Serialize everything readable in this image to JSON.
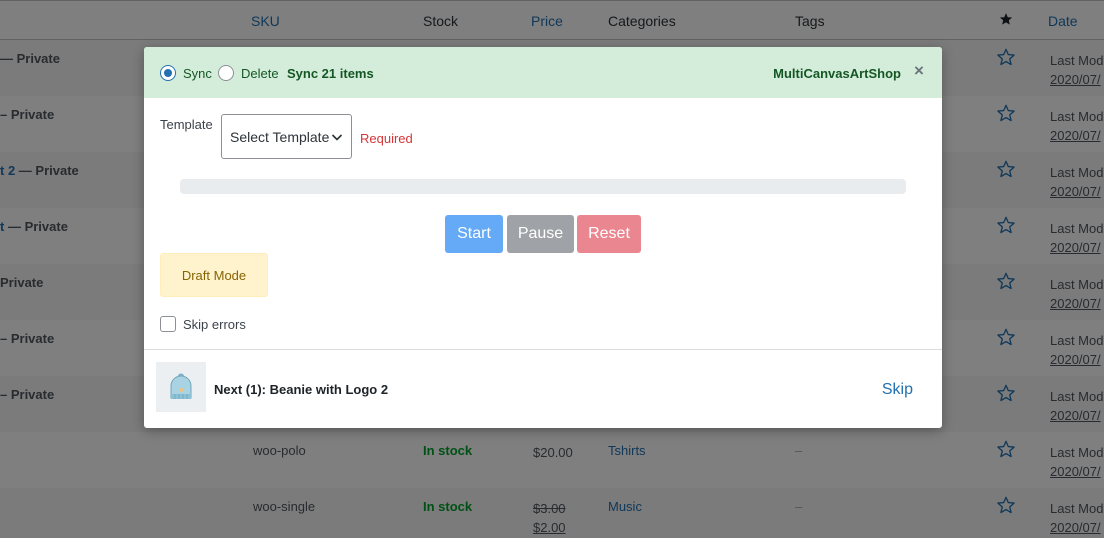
{
  "table": {
    "headers": {
      "sku": "SKU",
      "stock": "Stock",
      "price": "Price",
      "categories": "Categories",
      "tags": "Tags",
      "date": "Date"
    },
    "rows": [
      {
        "name": "",
        "state": "— Private",
        "sku": "",
        "stock": "",
        "price": "",
        "price_sale": "",
        "category": "",
        "tags": "",
        "date_label": "Last Mod",
        "date": "2020/07/"
      },
      {
        "name": "",
        "state": "– Private",
        "sku": "",
        "stock": "",
        "price": "",
        "price_sale": "",
        "category": "",
        "tags": "",
        "date_label": "Last Mod",
        "date": "2020/07/"
      },
      {
        "name": "t 2",
        "state": " — Private",
        "sku": "",
        "stock": "",
        "price": "",
        "price_sale": "",
        "category": "",
        "tags": "",
        "date_label": "Last Mod",
        "date": "2020/07/"
      },
      {
        "name": "t",
        "state": " — Private",
        "sku": "",
        "stock": "",
        "price": "",
        "price_sale": "",
        "category": "",
        "tags": "",
        "date_label": "Last Mod",
        "date": "2020/07/"
      },
      {
        "name": "",
        "state": "Private",
        "sku": "",
        "stock": "",
        "price": "",
        "price_sale": "",
        "category": "",
        "tags": "",
        "date_label": "Last Mod",
        "date": "2020/07/"
      },
      {
        "name": "",
        "state": "– Private",
        "sku": "",
        "stock": "",
        "price": "",
        "price_sale": "",
        "category": "",
        "tags": "",
        "date_label": "Last Mod",
        "date": "2020/07/"
      },
      {
        "name": "",
        "state": "– Private",
        "sku": "",
        "stock": "",
        "price": "",
        "price_sale": "",
        "category": "",
        "tags": "",
        "date_label": "Last Mod",
        "date": "2020/07/"
      },
      {
        "name": "",
        "state": "",
        "sku": "woo-polo",
        "stock": "In stock",
        "price": "$20.00",
        "price_sale": "",
        "category": "Tshirts",
        "tags": "–",
        "date_label": "Last Mod",
        "date": "2020/07/"
      },
      {
        "name": "",
        "state": "",
        "sku": "woo-single",
        "stock": "In stock",
        "price": "$3.00",
        "price_sale": "$2.00",
        "category": "Music",
        "tags": "–",
        "date_label": "Last Mod",
        "date": "2020/07/"
      }
    ]
  },
  "modal": {
    "sync_label": "Sync",
    "delete_label": "Delete",
    "count_label": "Sync 21 items",
    "shop_name": "MultiCanvasArtShop",
    "close_glyph": "×",
    "template_label": "Template",
    "template_selected": "Select Template",
    "required_text": "Required",
    "progress_percent": 0,
    "start_label": "Start",
    "pause_label": "Pause",
    "reset_label": "Reset",
    "draft_label": "Draft Mode",
    "skip_errors_label": "Skip errors",
    "next_label": "Next (1): Beanie with Logo 2",
    "skip_label": "Skip"
  },
  "colors": {
    "header_bg": "#d4edda",
    "header_text": "#155724",
    "start": "#64aaf7",
    "pause": "#9fa2a6",
    "reset": "#ea8690",
    "draft_bg": "#fff3cd",
    "required": "#d63638",
    "link": "#2271b1"
  }
}
